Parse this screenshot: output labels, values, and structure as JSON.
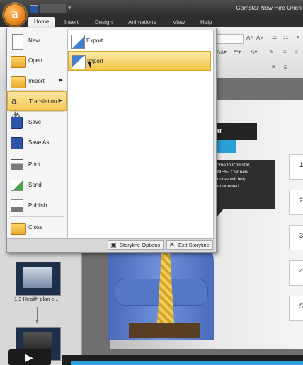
{
  "window": {
    "title": "Comstar New Hire Orien"
  },
  "app_logo": {
    "letter": "a"
  },
  "tabs": [
    "Home",
    "Insert",
    "Design",
    "Animations",
    "View",
    "Help"
  ],
  "menu": {
    "items": [
      {
        "label": "New",
        "icon": "new-document-icon"
      },
      {
        "label": "Open",
        "icon": "folder-open-icon"
      },
      {
        "label": "Import",
        "icon": "import-folder-icon",
        "has_submenu": true
      },
      {
        "label": "Translation",
        "icon": "translation-icon",
        "has_submenu": true,
        "highlighted": true
      },
      {
        "label": "Save",
        "icon": "save-disk-icon"
      },
      {
        "label": "Save As",
        "icon": "save-as-icon"
      },
      {
        "label": "Print",
        "icon": "printer-icon"
      },
      {
        "label": "Send",
        "icon": "send-icon"
      },
      {
        "label": "Publish",
        "icon": "publish-icon"
      },
      {
        "label": "Close",
        "icon": "close-folder-icon"
      }
    ],
    "submenu": [
      {
        "label": "Export",
        "icon": "export-icon"
      },
      {
        "label": "Import",
        "icon": "import-translation-icon",
        "highlighted": true
      }
    ],
    "footer": {
      "options_label": "Storyline Options",
      "exit_label": "Exit Storyline"
    }
  },
  "slide": {
    "banner": "tar",
    "speech_lines": [
      "elcome to Comstar,",
      "NAME%. Our new",
      "e course will help",
      "u get oriented."
    ],
    "numbers": [
      "1",
      "2",
      "3",
      "4",
      "5"
    ]
  },
  "left_pane": {
    "thumb_label": "1.3 Health plan c..."
  },
  "colors": {
    "highlight": "#f6c955",
    "accent_blue": "#2aa0d8",
    "logo_orange": "#e07a12"
  }
}
